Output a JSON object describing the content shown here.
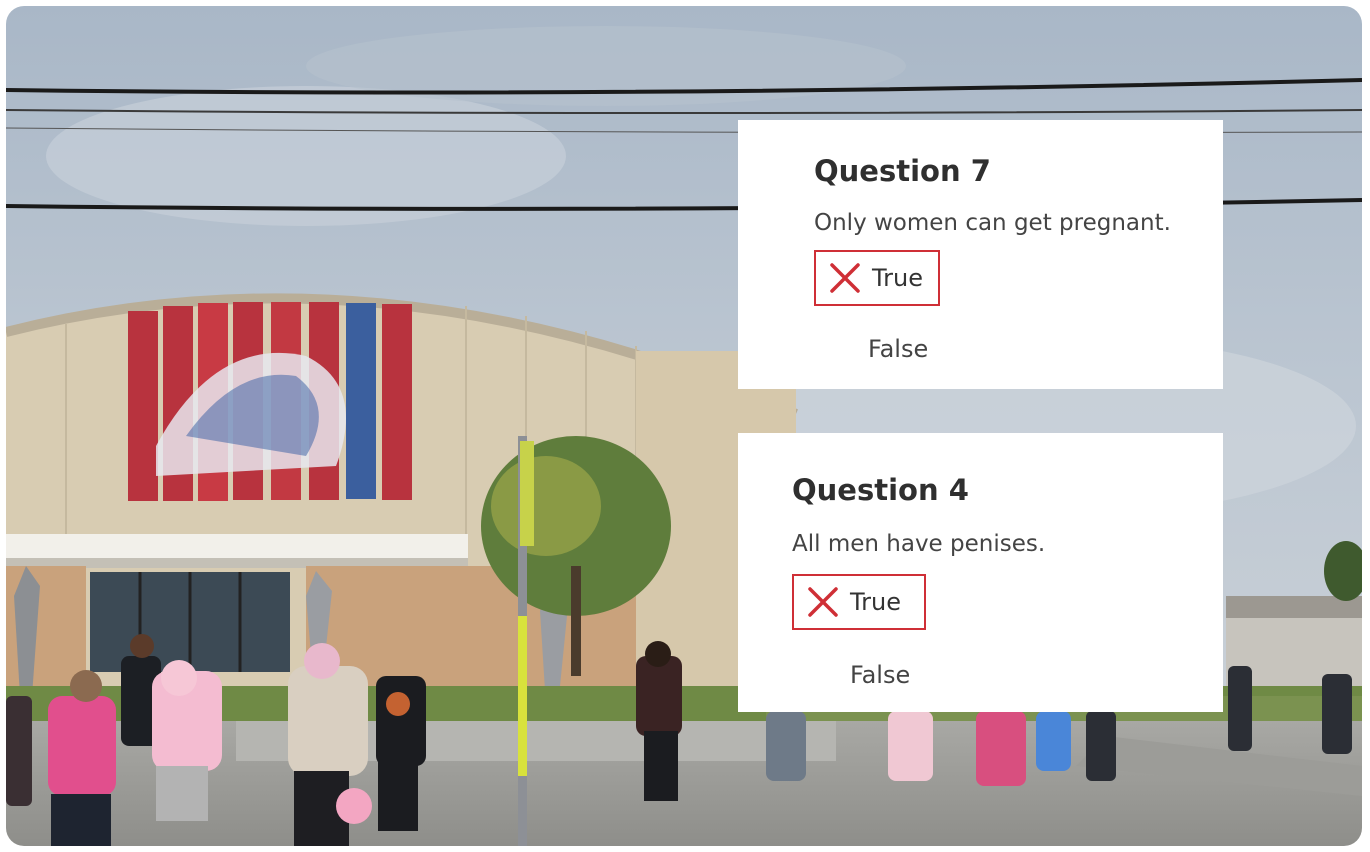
{
  "colors": {
    "card_background": "#ffffff",
    "incorrect_red": "#cf2f36"
  },
  "questions": [
    {
      "title": "Question 7",
      "text": "Only women can get pregnant.",
      "selected_answer": "True",
      "selected_icon": "x-mark-icon",
      "other_answer": "False"
    },
    {
      "title": "Question 4",
      "text": "All men have penises.",
      "selected_answer": "True",
      "selected_icon": "x-mark-icon",
      "other_answer": "False"
    }
  ]
}
